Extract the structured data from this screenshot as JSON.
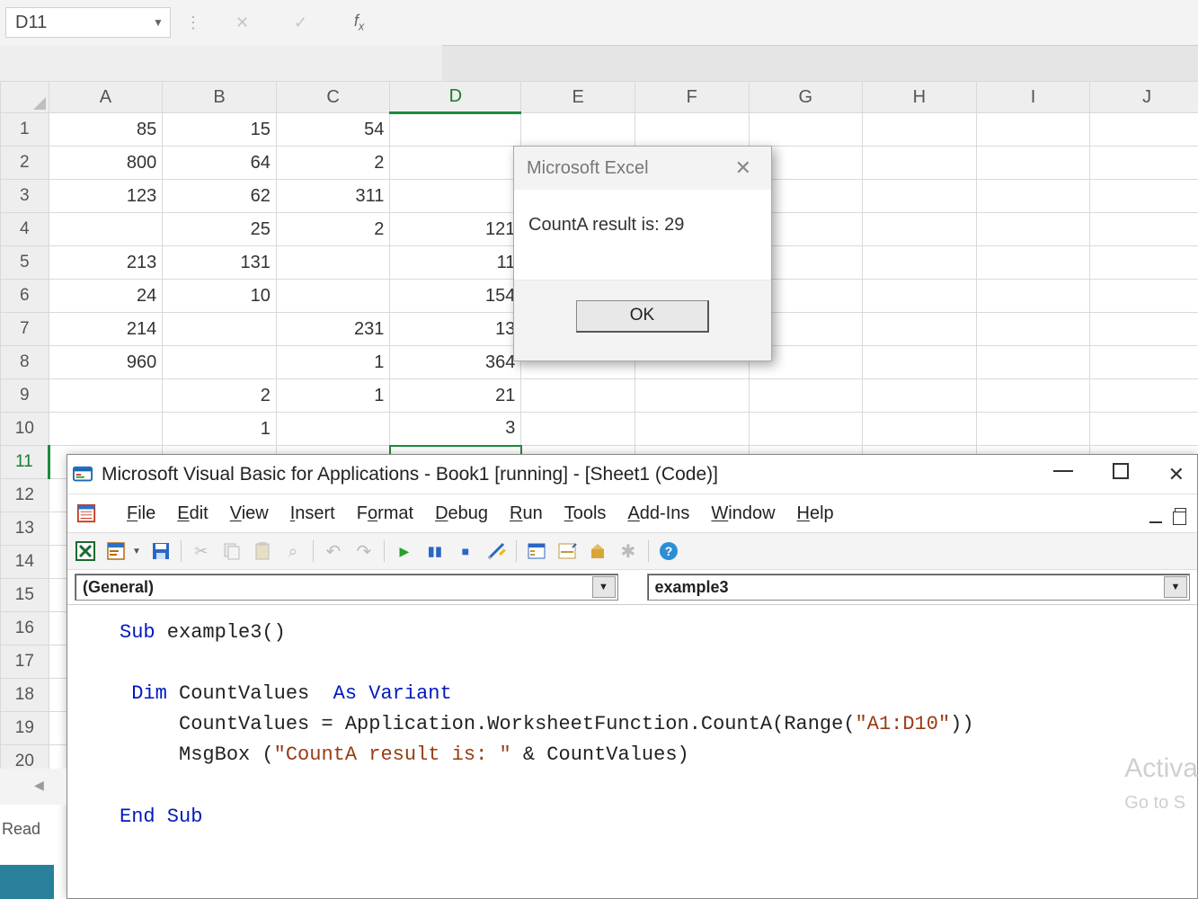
{
  "formula_bar": {
    "namebox": "D11",
    "fx_label": "fx"
  },
  "sheet": {
    "col_headers": [
      "A",
      "B",
      "C",
      "D",
      "E",
      "F",
      "G",
      "H",
      "I",
      "J"
    ],
    "row_headers": [
      "1",
      "2",
      "3",
      "4",
      "5",
      "6",
      "7",
      "8",
      "9",
      "10",
      "11",
      "12",
      "13",
      "14",
      "15",
      "16",
      "17",
      "18",
      "19",
      "20"
    ],
    "selected_col_index": 3,
    "selected_row_index": 10,
    "cells": [
      {
        "A": "85",
        "B": "15",
        "C": "54",
        "D": ""
      },
      {
        "A": "800",
        "B": "64",
        "C": "2",
        "D": ""
      },
      {
        "A": "123",
        "B": "62",
        "C": "311",
        "D": ""
      },
      {
        "A": "",
        "B": "25",
        "C": "2",
        "D": "121"
      },
      {
        "A": "213",
        "B": "131",
        "C": "",
        "D": "11"
      },
      {
        "A": "24",
        "B": "10",
        "C": "",
        "D": "154"
      },
      {
        "A": "214",
        "B": "",
        "C": "231",
        "D": "13"
      },
      {
        "A": "960",
        "B": "",
        "C": "1",
        "D": "364"
      },
      {
        "A": "",
        "B": "2",
        "C": "1",
        "D": "21"
      },
      {
        "A": "",
        "B": "1",
        "C": "",
        "D": "3"
      }
    ]
  },
  "msgbox": {
    "title": "Microsoft Excel",
    "body": "CountA result is: 29",
    "ok_label": "OK"
  },
  "vba": {
    "title": "Microsoft Visual Basic for Applications - Book1 [running] - [Sheet1 (Code)]",
    "menus": [
      "File",
      "Edit",
      "View",
      "Insert",
      "Format",
      "Debug",
      "Run",
      "Tools",
      "Add-Ins",
      "Window",
      "Help"
    ],
    "left_dropdown": "(General)",
    "right_dropdown": "example3",
    "code": {
      "l1_kw": "Sub",
      "l1_rest": " example3()",
      "l3_kw": "Dim",
      "l3_mid": " CountValues  ",
      "l3_kw2": "As Variant",
      "l4": "     CountValues = Application.WorksheetFunction.CountA(Range(",
      "l4_str": "\"A1:D10\"",
      "l4_end": "))",
      "l5a": "     MsgBox (",
      "l5_str": "\"CountA result is: \"",
      "l5b": " & CountValues)",
      "l7_kw": "End Sub"
    }
  },
  "status": {
    "ready": "Read"
  },
  "watermark": {
    "big": "Activa",
    "small": "Go to S"
  }
}
